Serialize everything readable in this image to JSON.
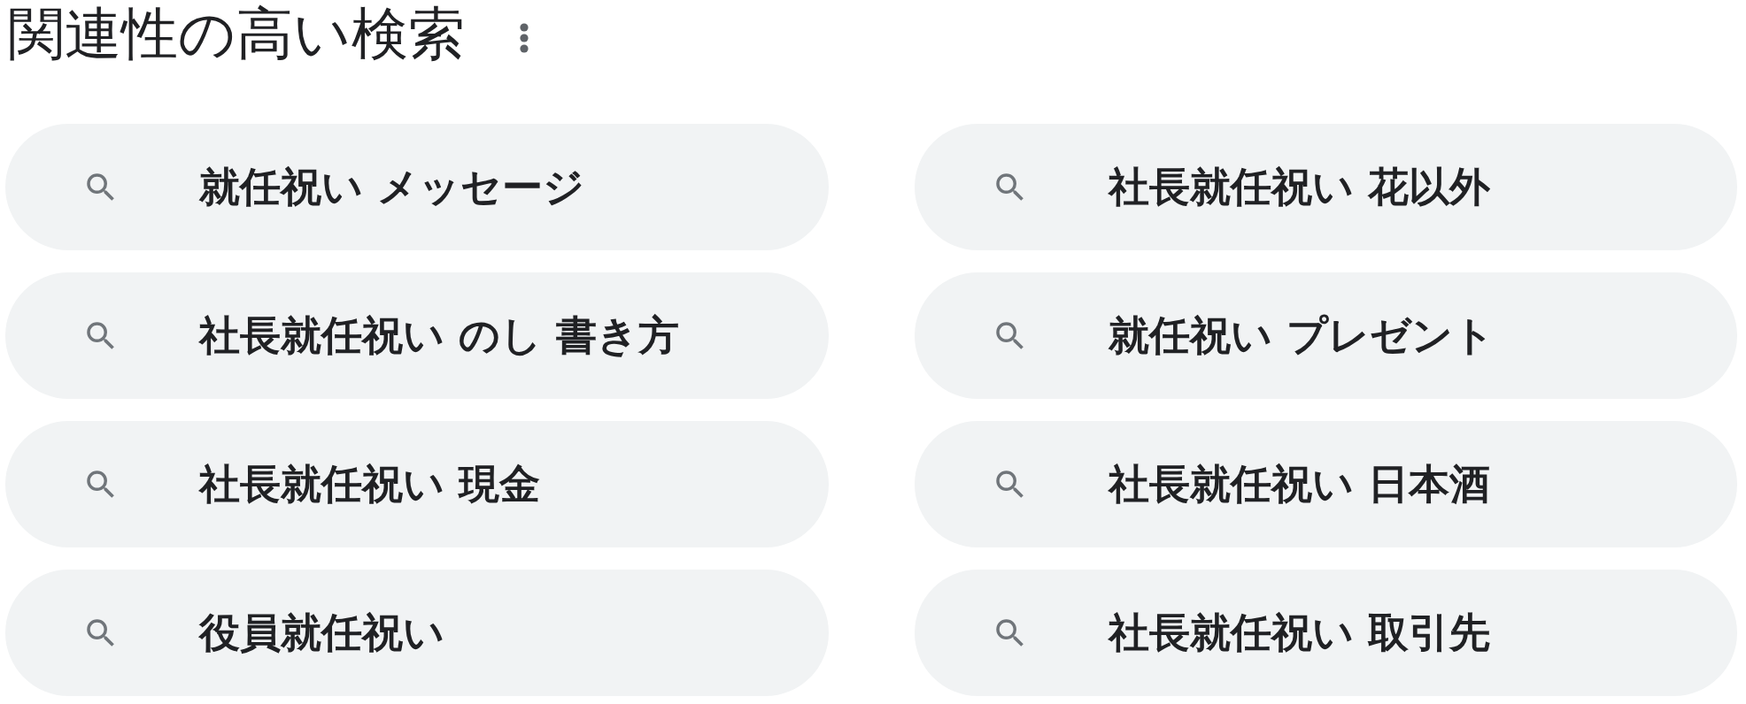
{
  "heading": {
    "title": "関連性の高い検索"
  },
  "related_searches": [
    {
      "query": "就任祝い メッセージ"
    },
    {
      "query": "社長就任祝い 花以外"
    },
    {
      "query": "社長就任祝い のし 書き方"
    },
    {
      "query": "就任祝い プレゼント"
    },
    {
      "query": "社長就任祝い 現金"
    },
    {
      "query": "社長就任祝い 日本酒"
    },
    {
      "query": "役員就任祝い"
    },
    {
      "query": "社長就任祝い 取引先"
    }
  ]
}
